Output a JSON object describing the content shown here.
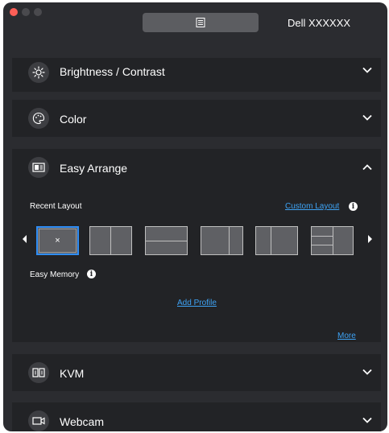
{
  "window": {
    "title": "Dell XXXXXX",
    "controls": [
      "close",
      "minimize",
      "zoom"
    ],
    "menu_icon": "document-list-icon"
  },
  "sections": {
    "brightness": {
      "label": "Brightness / Contrast",
      "icon": "sun-icon",
      "state": "collapsed"
    },
    "color": {
      "label": "Color",
      "icon": "palette-icon",
      "state": "collapsed"
    },
    "easy_arrange": {
      "label": "Easy Arrange",
      "icon": "window-layout-icon",
      "state": "expanded",
      "recent_layout_label": "Recent Layout",
      "custom_layout_link": "Custom Layout",
      "info_glyph": "i",
      "layouts": [
        {
          "type": "off",
          "glyph": "×",
          "selected": true
        },
        {
          "type": "two-columns"
        },
        {
          "type": "two-rows"
        },
        {
          "type": "two-columns-right-narrow"
        },
        {
          "type": "two-columns-left-narrow"
        },
        {
          "type": "right-split-stack"
        }
      ],
      "easy_memory_label": "Easy Memory",
      "add_profile_link": "Add Profile",
      "more_link": "More"
    },
    "kvm": {
      "label": "KVM",
      "icon": "kvm-icon",
      "state": "collapsed"
    },
    "webcam": {
      "label": "Webcam",
      "icon": "webcam-icon",
      "state": "collapsed"
    }
  },
  "colors": {
    "window_bg": "#2b2c30",
    "panel_bg": "#222326",
    "link": "#3ea3f5",
    "selection": "#2f8df5",
    "close": "#fd5f57"
  }
}
